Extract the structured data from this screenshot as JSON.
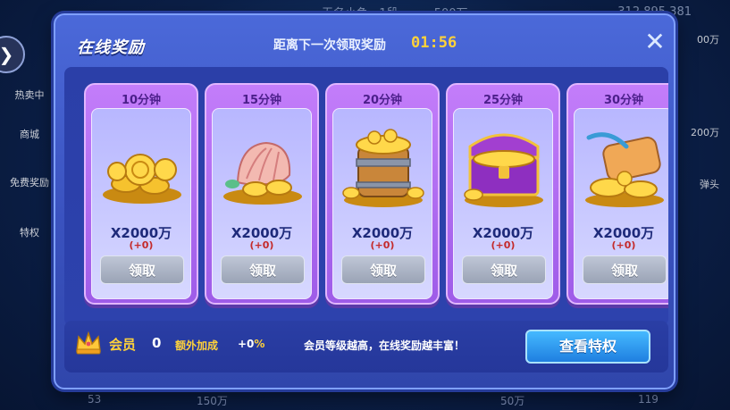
{
  "background": {
    "top_name": "无名小鱼",
    "top_level": "· 1段",
    "top_bet": "500万",
    "top_score": "312,895,381",
    "right_value_1": "00万",
    "right_value_2": "200万",
    "right_item": "弹头",
    "left_items": [
      "热卖中",
      "商城",
      "免费奖励",
      "特权"
    ],
    "bottom_left": "53",
    "bottom_mid_1": "150万",
    "bottom_mid_2": "50万",
    "bottom_right": "119"
  },
  "modal": {
    "title": "在线奖励",
    "countdown_label": "距离下一次领取奖励",
    "countdown": "01:56",
    "close_icon": "close-icon"
  },
  "cards": [
    {
      "time": "10分钟",
      "amount": "X2000万",
      "bonus": "(+0)",
      "button": "领取",
      "art": "coin-pile"
    },
    {
      "time": "15分钟",
      "amount": "X2000万",
      "bonus": "(+0)",
      "button": "领取",
      "art": "shell-coins"
    },
    {
      "time": "20分钟",
      "amount": "X2000万",
      "bonus": "(+0)",
      "button": "领取",
      "art": "coin-barrel"
    },
    {
      "time": "25分钟",
      "amount": "X2000万",
      "bonus": "(+0)",
      "button": "领取",
      "art": "treasure-chest"
    },
    {
      "time": "30分钟",
      "amount": "X2000万",
      "bonus": "(+0)",
      "button": "领取",
      "art": "treasure-map"
    }
  ],
  "footer": {
    "member_label": "会员",
    "member_level": "0",
    "extra_label": "额外加成",
    "extra_value": "+0",
    "extra_pct": "%",
    "hint": "会员等级越高，在线奖励越丰富！",
    "view_button": "查看特权"
  },
  "colors": {
    "modal_blue": "#4b69d9",
    "card_purple": "#c37dfa",
    "countdown_yellow": "#ffd23a",
    "view_button_blue": "#2a8ff0"
  }
}
